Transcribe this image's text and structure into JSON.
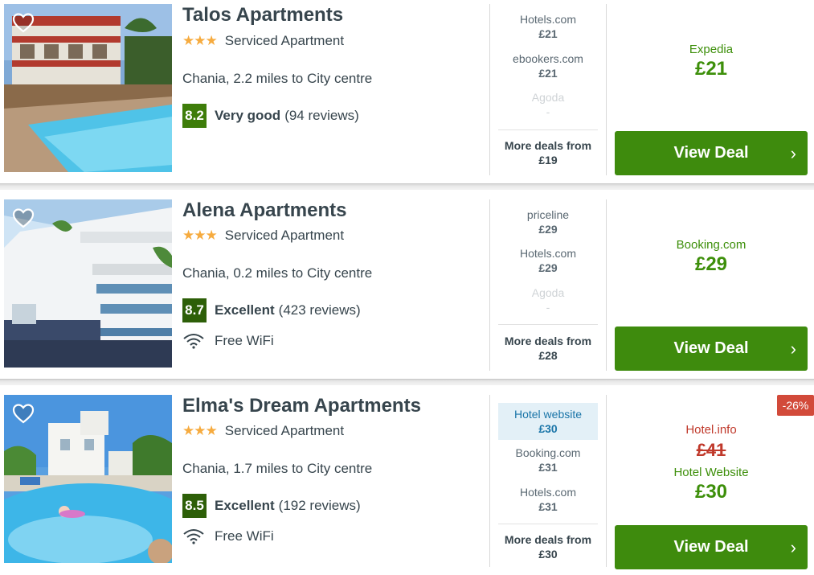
{
  "colors": {
    "accent_green": "#3e8b0d",
    "score_green": "#3e7d0a",
    "score_dark": "#2d5f08",
    "star": "#f6ab3f",
    "discount_red": "#d24a3a"
  },
  "hotels": [
    {
      "name": "Talos Apartments",
      "stars": "★★★",
      "type": "Serviced Apartment",
      "location": "Chania, 2.2 miles to City centre",
      "score": "8.2",
      "rating_word": "Very good",
      "reviews": "(94 reviews)",
      "deals": [
        {
          "provider": "Hotels.com",
          "price": "£21"
        },
        {
          "provider": "ebookers.com",
          "price": "£21"
        },
        {
          "provider": "Agoda",
          "price": "-"
        }
      ],
      "more_label": "More deals from",
      "more_price": "£19",
      "main_provider": "Expedia",
      "main_price": "£21",
      "button": "View Deal"
    },
    {
      "name": "Alena Apartments",
      "stars": "★★★",
      "type": "Serviced Apartment",
      "location": "Chania, 0.2 miles to City centre",
      "score": "8.7",
      "rating_word": "Excellent",
      "reviews": "(423 reviews)",
      "amenity": "Free WiFi",
      "deals": [
        {
          "provider": "priceline",
          "price": "£29"
        },
        {
          "provider": "Hotels.com",
          "price": "£29"
        },
        {
          "provider": "Agoda",
          "price": "-"
        }
      ],
      "more_label": "More deals from",
      "more_price": "£28",
      "main_provider": "Booking.com",
      "main_price": "£29",
      "button": "View Deal"
    },
    {
      "name": "Elma's Dream Apartments",
      "stars": "★★★",
      "type": "Serviced Apartment",
      "location": "Chania, 1.7 miles to City centre",
      "score": "8.5",
      "rating_word": "Excellent",
      "reviews": "(192 reviews)",
      "amenity": "Free WiFi",
      "deals": [
        {
          "provider": "Hotel website",
          "price": "£30"
        },
        {
          "provider": "Booking.com",
          "price": "£31"
        },
        {
          "provider": "Hotels.com",
          "price": "£31"
        }
      ],
      "more_label": "More deals from",
      "more_price": "£30",
      "discount": "-26%",
      "old_provider": "Hotel.info",
      "old_price": "£41",
      "main_provider": "Hotel Website",
      "main_price": "£30",
      "button": "View Deal"
    }
  ]
}
